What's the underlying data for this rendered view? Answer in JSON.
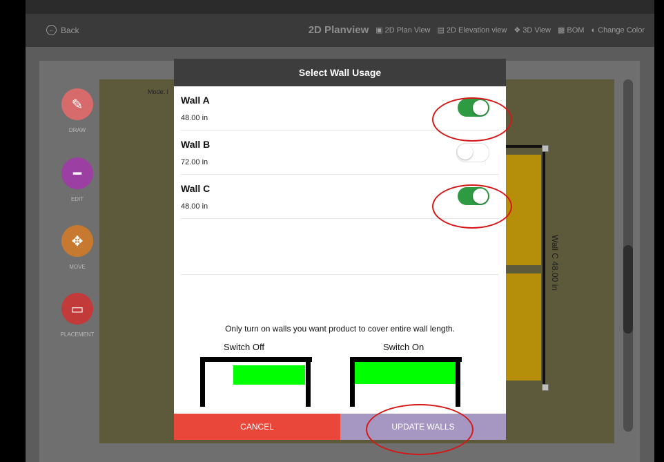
{
  "nav": {
    "back_label": "Back",
    "title": "2D Planview",
    "items": [
      {
        "label": "2D Plan View",
        "icon": "plan-icon"
      },
      {
        "label": "2D Elevation view",
        "icon": "elevation-icon"
      },
      {
        "label": "3D View",
        "icon": "cube-icon"
      },
      {
        "label": "BOM",
        "icon": "document-icon"
      },
      {
        "label": "Change Color",
        "icon": "palette-icon"
      }
    ]
  },
  "tools": [
    {
      "label": "DRAW",
      "icon": "pencil-icon",
      "color": "#d76a6a"
    },
    {
      "label": "EDIT",
      "icon": "ruler-icon",
      "color": "#9b3fa2"
    },
    {
      "label": "MOVE",
      "icon": "move-arrows-icon",
      "color": "#c77a2f"
    },
    {
      "label": "PLACEMENT",
      "icon": "rectangle-icon",
      "color": "#c23a3a"
    }
  ],
  "mode_label": "Mode: I",
  "wall_label": "Wall C 48.00 in",
  "dialog": {
    "title": "Select Wall Usage",
    "walls": [
      {
        "name": "Wall A",
        "length": "48.00 in",
        "on": true
      },
      {
        "name": "Wall B",
        "length": "72.00 in",
        "on": false
      },
      {
        "name": "Wall C",
        "length": "48.00 in",
        "on": true
      }
    ],
    "info": "Only turn on walls you want product to cover entire wall length.",
    "switch_off_label": "Switch Off",
    "switch_on_label": "Switch On",
    "cancel_label": "CANCEL",
    "update_label": "UPDATE WALLS"
  },
  "colors": {
    "toggle_on": "#2e9b43",
    "cancel": "#e8473a",
    "update": "#a597c2",
    "annotation": "#d61717",
    "diagram_fill": "#00ff00"
  }
}
